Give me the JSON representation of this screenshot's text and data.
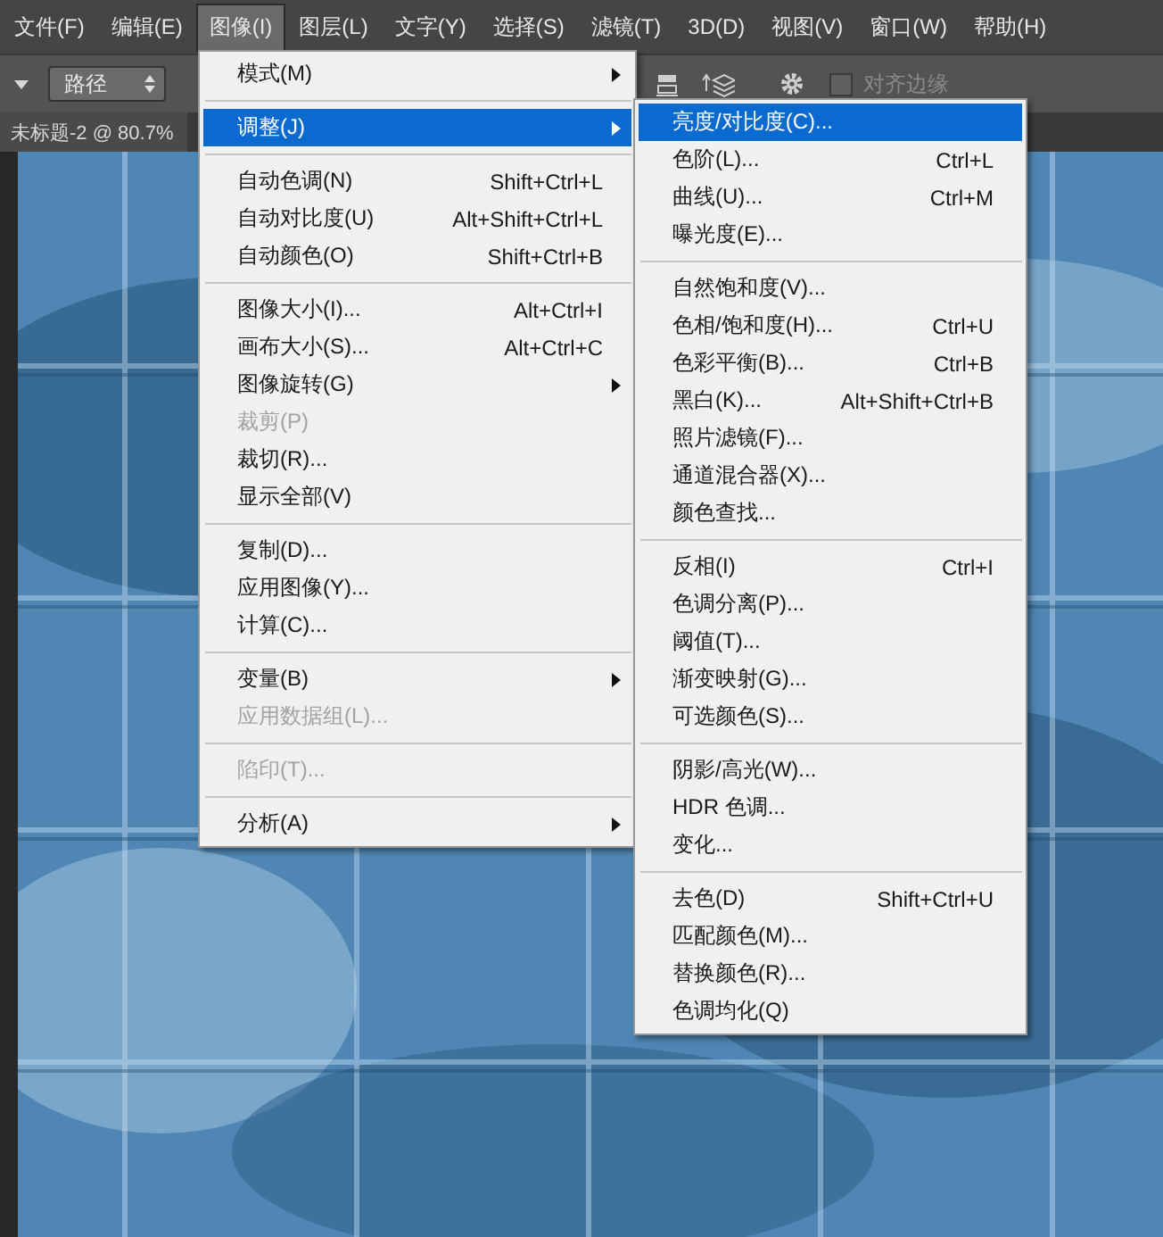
{
  "menubar": [
    {
      "label": "文件(F)",
      "selected": false
    },
    {
      "label": "编辑(E)",
      "selected": false
    },
    {
      "label": "图像(I)",
      "selected": true
    },
    {
      "label": "图层(L)",
      "selected": false
    },
    {
      "label": "文字(Y)",
      "selected": false
    },
    {
      "label": "选择(S)",
      "selected": false
    },
    {
      "label": "滤镜(T)",
      "selected": false
    },
    {
      "label": "3D(D)",
      "selected": false
    },
    {
      "label": "视图(V)",
      "selected": false
    },
    {
      "label": "窗口(W)",
      "selected": false
    },
    {
      "label": "帮助(H)",
      "selected": false
    }
  ],
  "toolbar": {
    "mode_select": "路径",
    "align_edges": {
      "label": "对齐边缘",
      "checked": false
    }
  },
  "document_tab": {
    "title": "未标题-2 @ 80.7%"
  },
  "image_menu": [
    {
      "kind": "item",
      "label": "模式(M)",
      "submenu": true,
      "selected": false,
      "disabled": false
    },
    {
      "kind": "separator"
    },
    {
      "kind": "item",
      "label": "调整(J)",
      "submenu": true,
      "selected": true,
      "disabled": false
    },
    {
      "kind": "separator"
    },
    {
      "kind": "item",
      "label": "自动色调(N)",
      "shortcut": "Shift+Ctrl+L",
      "selected": false,
      "disabled": false
    },
    {
      "kind": "item",
      "label": "自动对比度(U)",
      "shortcut": "Alt+Shift+Ctrl+L",
      "selected": false,
      "disabled": false
    },
    {
      "kind": "item",
      "label": "自动颜色(O)",
      "shortcut": "Shift+Ctrl+B",
      "selected": false,
      "disabled": false
    },
    {
      "kind": "separator"
    },
    {
      "kind": "item",
      "label": "图像大小(I)...",
      "shortcut": "Alt+Ctrl+I",
      "selected": false,
      "disabled": false
    },
    {
      "kind": "item",
      "label": "画布大小(S)...",
      "shortcut": "Alt+Ctrl+C",
      "selected": false,
      "disabled": false
    },
    {
      "kind": "item",
      "label": "图像旋转(G)",
      "submenu": true,
      "selected": false,
      "disabled": false
    },
    {
      "kind": "item",
      "label": "裁剪(P)",
      "selected": false,
      "disabled": true
    },
    {
      "kind": "item",
      "label": "裁切(R)...",
      "selected": false,
      "disabled": false
    },
    {
      "kind": "item",
      "label": "显示全部(V)",
      "selected": false,
      "disabled": false
    },
    {
      "kind": "separator"
    },
    {
      "kind": "item",
      "label": "复制(D)...",
      "selected": false,
      "disabled": false
    },
    {
      "kind": "item",
      "label": "应用图像(Y)...",
      "selected": false,
      "disabled": false
    },
    {
      "kind": "item",
      "label": "计算(C)...",
      "selected": false,
      "disabled": false
    },
    {
      "kind": "separator"
    },
    {
      "kind": "item",
      "label": "变量(B)",
      "submenu": true,
      "selected": false,
      "disabled": false
    },
    {
      "kind": "item",
      "label": "应用数据组(L)...",
      "selected": false,
      "disabled": true
    },
    {
      "kind": "separator"
    },
    {
      "kind": "item",
      "label": "陷印(T)...",
      "selected": false,
      "disabled": true
    },
    {
      "kind": "separator"
    },
    {
      "kind": "item",
      "label": "分析(A)",
      "submenu": true,
      "selected": false,
      "disabled": false
    }
  ],
  "adjust_submenu": [
    {
      "kind": "item",
      "label": "亮度/对比度(C)...",
      "selected": true,
      "disabled": false
    },
    {
      "kind": "item",
      "label": "色阶(L)...",
      "shortcut": "Ctrl+L",
      "selected": false,
      "disabled": false
    },
    {
      "kind": "item",
      "label": "曲线(U)...",
      "shortcut": "Ctrl+M",
      "selected": false,
      "disabled": false
    },
    {
      "kind": "item",
      "label": "曝光度(E)...",
      "selected": false,
      "disabled": false
    },
    {
      "kind": "separator"
    },
    {
      "kind": "item",
      "label": "自然饱和度(V)...",
      "selected": false,
      "disabled": false
    },
    {
      "kind": "item",
      "label": "色相/饱和度(H)...",
      "shortcut": "Ctrl+U",
      "selected": false,
      "disabled": false
    },
    {
      "kind": "item",
      "label": "色彩平衡(B)...",
      "shortcut": "Ctrl+B",
      "selected": false,
      "disabled": false
    },
    {
      "kind": "item",
      "label": "黑白(K)...",
      "shortcut": "Alt+Shift+Ctrl+B",
      "selected": false,
      "disabled": false
    },
    {
      "kind": "item",
      "label": "照片滤镜(F)...",
      "selected": false,
      "disabled": false
    },
    {
      "kind": "item",
      "label": "通道混合器(X)...",
      "selected": false,
      "disabled": false
    },
    {
      "kind": "item",
      "label": "颜色查找...",
      "selected": false,
      "disabled": false
    },
    {
      "kind": "separator"
    },
    {
      "kind": "item",
      "label": "反相(I)",
      "shortcut": "Ctrl+I",
      "selected": false,
      "disabled": false
    },
    {
      "kind": "item",
      "label": "色调分离(P)...",
      "selected": false,
      "disabled": false
    },
    {
      "kind": "item",
      "label": "阈值(T)...",
      "selected": false,
      "disabled": false
    },
    {
      "kind": "item",
      "label": "渐变映射(G)...",
      "selected": false,
      "disabled": false
    },
    {
      "kind": "item",
      "label": "可选颜色(S)...",
      "selected": false,
      "disabled": false
    },
    {
      "kind": "separator"
    },
    {
      "kind": "item",
      "label": "阴影/高光(W)...",
      "selected": false,
      "disabled": false
    },
    {
      "kind": "item",
      "label": "HDR 色调...",
      "selected": false,
      "disabled": false
    },
    {
      "kind": "item",
      "label": "变化...",
      "selected": false,
      "disabled": false
    },
    {
      "kind": "separator"
    },
    {
      "kind": "item",
      "label": "去色(D)",
      "shortcut": "Shift+Ctrl+U",
      "selected": false,
      "disabled": false
    },
    {
      "kind": "item",
      "label": "匹配颜色(M)...",
      "selected": false,
      "disabled": false
    },
    {
      "kind": "item",
      "label": "替换颜色(R)...",
      "selected": false,
      "disabled": false
    },
    {
      "kind": "item",
      "label": "色调均化(Q)",
      "selected": false,
      "disabled": false
    }
  ]
}
